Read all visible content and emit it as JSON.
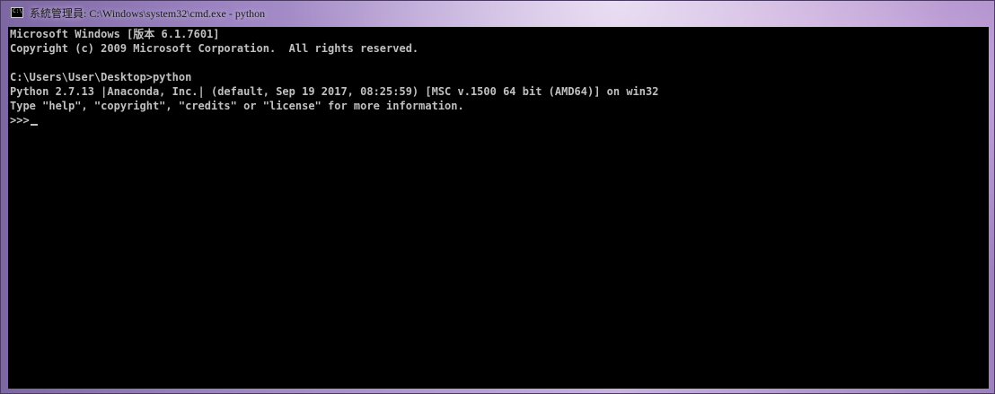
{
  "window": {
    "title": "系統管理員: C:\\Windows\\system32\\cmd.exe - python",
    "icon": "console-icon"
  },
  "console": {
    "lines": [
      "Microsoft Windows [版本 6.1.7601]",
      "Copyright (c) 2009 Microsoft Corporation.  All rights reserved.",
      "",
      "C:\\Users\\User\\Desktop>python",
      "Python 2.7.13 |Anaconda, Inc.| (default, Sep 19 2017, 08:25:59) [MSC v.1500 64 bit (AMD64)] on win32",
      "Type \"help\", \"copyright\", \"credits\" or \"license\" for more information.",
      ">>>"
    ]
  },
  "colors": {
    "console_bg": "#000000",
    "console_text": "#c0c0c0",
    "frame_accent": "#b49bd1"
  }
}
